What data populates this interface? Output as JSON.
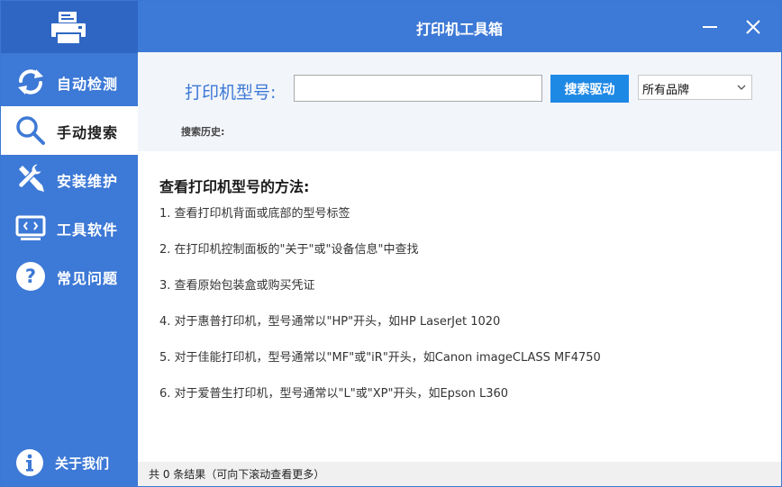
{
  "window": {
    "title": "打印机工具箱"
  },
  "sidebar": {
    "items": [
      {
        "label": "自动检测",
        "icon": "refresh-icon",
        "active": false
      },
      {
        "label": "手动搜索",
        "icon": "search-icon",
        "active": true
      },
      {
        "label": "安装维护",
        "icon": "tools-icon",
        "active": false
      },
      {
        "label": "工具软件",
        "icon": "code-monitor-icon",
        "active": false
      },
      {
        "label": "常见问题",
        "icon": "question-icon",
        "active": false
      }
    ],
    "about": {
      "label": "关于我们",
      "icon": "info-icon"
    }
  },
  "search": {
    "model_label": "打印机型号:",
    "model_value": "",
    "model_placeholder": "",
    "search_button": "搜索驱动",
    "brand_selected": "所有品牌",
    "history_label": "搜索历史:"
  },
  "help": {
    "heading": "查看打印机型号的方法:",
    "steps": [
      "1. 查看打印机背面或底部的型号标签",
      "2. 在打印机控制面板的\"关于\"或\"设备信息\"中查找",
      "3. 查看原始包装盒或购买凭证",
      "4. 对于惠普打印机，型号通常以\"HP\"开头，如HP LaserJet 1020",
      "5. 对于佳能打印机，型号通常以\"MF\"或\"iR\"开头，如Canon imageCLASS MF4750",
      "6. 对于爱普生打印机，型号通常以\"L\"或\"XP\"开头，如Epson L360"
    ]
  },
  "status": {
    "text": "共 0 条结果（可向下滚动查看更多）"
  },
  "colors": {
    "sidebar": "#3d79d6",
    "logo_bg": "#2f66c4",
    "accent": "#1e88e5",
    "panel_bg": "#f2f5fa"
  }
}
